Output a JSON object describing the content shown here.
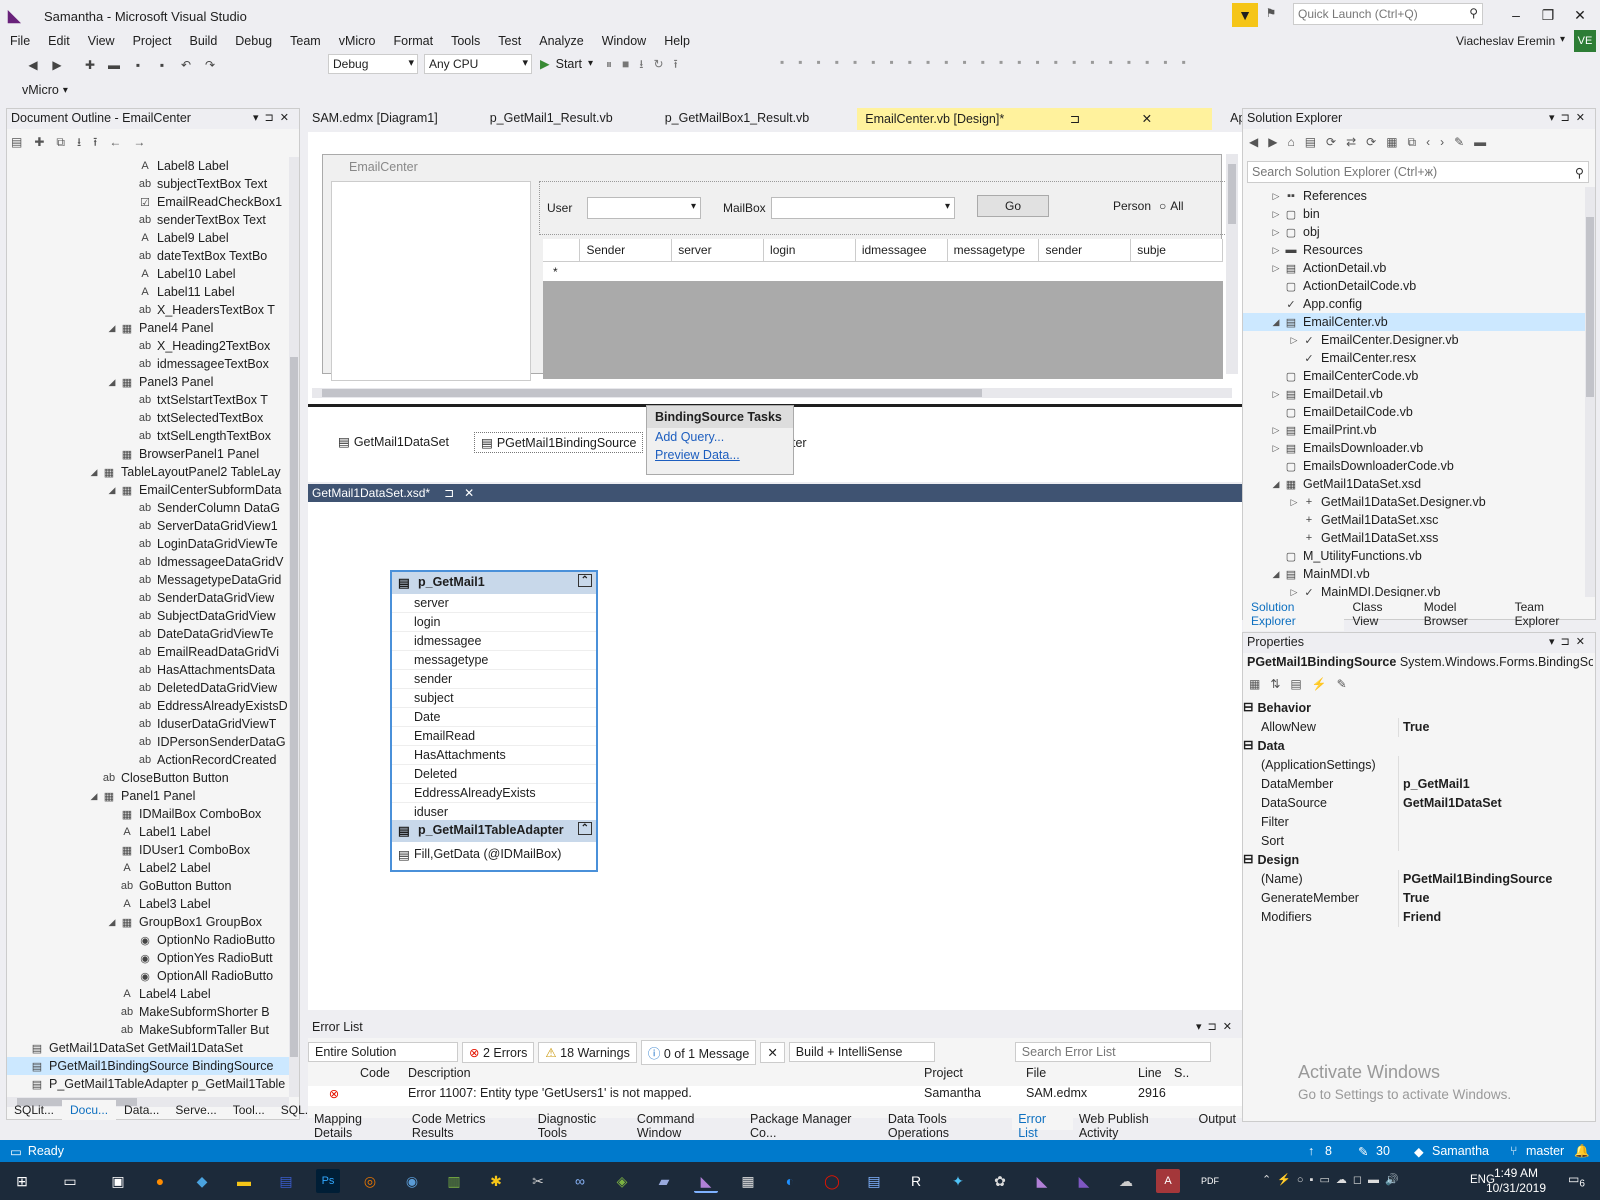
{
  "window": {
    "title": "Samantha - Microsoft Visual Studio",
    "quick_launch": "Quick Launch (Ctrl+Q)",
    "user": "Viacheslav Eremin",
    "user_initials": "VE"
  },
  "menu": [
    "File",
    "Edit",
    "View",
    "Project",
    "Build",
    "Debug",
    "Team",
    "vMicro",
    "Format",
    "Tools",
    "Test",
    "Analyze",
    "Window",
    "Help"
  ],
  "toolbar": {
    "config": "Debug",
    "platform": "Any CPU",
    "start": "Start",
    "vmicro": "vMicro"
  },
  "doc_outline": {
    "title": "Document Outline - EmailCenter",
    "items": [
      {
        "indent": 7,
        "exp": "",
        "icon": "A",
        "text": "Label8  Label"
      },
      {
        "indent": 7,
        "exp": "",
        "icon": "ab",
        "text": "subjectTextBox  Text"
      },
      {
        "indent": 7,
        "exp": "",
        "icon": "☑",
        "text": "EmailReadCheckBox1"
      },
      {
        "indent": 7,
        "exp": "",
        "icon": "ab",
        "text": "senderTextBox  Text"
      },
      {
        "indent": 7,
        "exp": "",
        "icon": "A",
        "text": "Label9  Label"
      },
      {
        "indent": 7,
        "exp": "",
        "icon": "ab",
        "text": "dateTextBox  TextBo"
      },
      {
        "indent": 7,
        "exp": "",
        "icon": "A",
        "text": "Label10  Label"
      },
      {
        "indent": 7,
        "exp": "",
        "icon": "A",
        "text": "Label11  Label"
      },
      {
        "indent": 7,
        "exp": "",
        "icon": "ab",
        "text": "X_HeadersTextBox  T"
      },
      {
        "indent": 6,
        "exp": "◢",
        "icon": "▦",
        "text": "Panel4  Panel"
      },
      {
        "indent": 7,
        "exp": "",
        "icon": "ab",
        "text": "X_Heading2TextBox"
      },
      {
        "indent": 7,
        "exp": "",
        "icon": "ab",
        "text": "idmessageeTextBox"
      },
      {
        "indent": 6,
        "exp": "◢",
        "icon": "▦",
        "text": "Panel3  Panel"
      },
      {
        "indent": 7,
        "exp": "",
        "icon": "ab",
        "text": "txtSelstartTextBox  T"
      },
      {
        "indent": 7,
        "exp": "",
        "icon": "ab",
        "text": "txtSelectedTextBox"
      },
      {
        "indent": 7,
        "exp": "",
        "icon": "ab",
        "text": "txtSelLengthTextBox"
      },
      {
        "indent": 6,
        "exp": "",
        "icon": "▦",
        "text": "BrowserPanel1  Panel"
      },
      {
        "indent": 5,
        "exp": "◢",
        "icon": "▦",
        "text": "TableLayoutPanel2  TableLay"
      },
      {
        "indent": 6,
        "exp": "◢",
        "icon": "▦",
        "text": "EmailCenterSubformData"
      },
      {
        "indent": 7,
        "exp": "",
        "icon": "ab",
        "text": "SenderColumn  DataG"
      },
      {
        "indent": 7,
        "exp": "",
        "icon": "ab",
        "text": "ServerDataGridView1"
      },
      {
        "indent": 7,
        "exp": "",
        "icon": "ab",
        "text": "LoginDataGridViewTe"
      },
      {
        "indent": 7,
        "exp": "",
        "icon": "ab",
        "text": "IdmessageeDataGridV"
      },
      {
        "indent": 7,
        "exp": "",
        "icon": "ab",
        "text": "MessagetypeDataGrid"
      },
      {
        "indent": 7,
        "exp": "",
        "icon": "ab",
        "text": "SenderDataGridView"
      },
      {
        "indent": 7,
        "exp": "",
        "icon": "ab",
        "text": "SubjectDataGridView"
      },
      {
        "indent": 7,
        "exp": "",
        "icon": "ab",
        "text": "DateDataGridViewTe"
      },
      {
        "indent": 7,
        "exp": "",
        "icon": "ab",
        "text": "EmailReadDataGridVi"
      },
      {
        "indent": 7,
        "exp": "",
        "icon": "ab",
        "text": "HasAttachmentsData"
      },
      {
        "indent": 7,
        "exp": "",
        "icon": "ab",
        "text": "DeletedDataGridView"
      },
      {
        "indent": 7,
        "exp": "",
        "icon": "ab",
        "text": "EddressAlreadyExistsD"
      },
      {
        "indent": 7,
        "exp": "",
        "icon": "ab",
        "text": "IduserDataGridViewT"
      },
      {
        "indent": 7,
        "exp": "",
        "icon": "ab",
        "text": "IDPersonSenderDataG"
      },
      {
        "indent": 7,
        "exp": "",
        "icon": "ab",
        "text": "ActionRecordCreated"
      },
      {
        "indent": 5,
        "exp": "",
        "icon": "ab",
        "text": "CloseButton  Button"
      },
      {
        "indent": 5,
        "exp": "◢",
        "icon": "▦",
        "text": "Panel1  Panel"
      },
      {
        "indent": 6,
        "exp": "",
        "icon": "▦",
        "text": "IDMailBox  ComboBox"
      },
      {
        "indent": 6,
        "exp": "",
        "icon": "A",
        "text": "Label1  Label"
      },
      {
        "indent": 6,
        "exp": "",
        "icon": "▦",
        "text": "IDUser1  ComboBox"
      },
      {
        "indent": 6,
        "exp": "",
        "icon": "A",
        "text": "Label2  Label"
      },
      {
        "indent": 6,
        "exp": "",
        "icon": "ab",
        "text": "GoButton  Button"
      },
      {
        "indent": 6,
        "exp": "",
        "icon": "A",
        "text": "Label3  Label"
      },
      {
        "indent": 6,
        "exp": "◢",
        "icon": "▦",
        "text": "GroupBox1  GroupBox"
      },
      {
        "indent": 7,
        "exp": "",
        "icon": "◉",
        "text": "OptionNo  RadioButto"
      },
      {
        "indent": 7,
        "exp": "",
        "icon": "◉",
        "text": "OptionYes  RadioButt"
      },
      {
        "indent": 7,
        "exp": "",
        "icon": "◉",
        "text": "OptionAll  RadioButto"
      },
      {
        "indent": 6,
        "exp": "",
        "icon": "A",
        "text": "Label4  Label"
      },
      {
        "indent": 6,
        "exp": "",
        "icon": "ab",
        "text": "MakeSubformShorter  B"
      },
      {
        "indent": 6,
        "exp": "",
        "icon": "ab",
        "text": "MakeSubformTaller  But"
      },
      {
        "indent": 1,
        "exp": "",
        "icon": "▤",
        "text": "GetMail1DataSet  GetMail1DataSet"
      },
      {
        "indent": 1,
        "exp": "",
        "icon": "▤",
        "text": "PGetMail1BindingSource  BindingSource",
        "selected": true
      },
      {
        "indent": 1,
        "exp": "",
        "icon": "▤",
        "text": "P_GetMail1TableAdapter  p_GetMail1Table"
      }
    ],
    "tabs": [
      "SQLit...",
      "Docu...",
      "Data...",
      "Serve...",
      "Tool...",
      "SQL..."
    ]
  },
  "doc_tabs": [
    "SAM.edmx [Diagram1]",
    "p_GetMail1_Result.vb",
    "p_GetMailBox1_Result.vb",
    "EmailCenter.vb [Design]*",
    "App.config"
  ],
  "designer": {
    "form_title": "EmailCenter",
    "user_label": "User",
    "mailbox_label": "MailBox",
    "go": "Go",
    "person_label": "Person",
    "all_label": "All",
    "grid_cols": [
      "Sender",
      "server",
      "login",
      "idmessagee",
      "messagetype",
      "sender",
      "subje"
    ],
    "new_row": "*",
    "components": [
      "GetMail1DataSet",
      "PGetMail1BindingSource",
      "ter"
    ],
    "tasks": {
      "title": "BindingSource Tasks",
      "items": [
        "Add Query...",
        "Preview Data..."
      ]
    }
  },
  "xsd": {
    "tab": "GetMail1DataSet.xsd*",
    "table": "p_GetMail1",
    "columns": [
      "server",
      "login",
      "idmessagee",
      "messagetype",
      "sender",
      "subject",
      "Date",
      "EmailRead",
      "HasAttachments",
      "Deleted",
      "EddressAlreadyExists",
      "iduser"
    ],
    "adapter": "p_GetMail1TableAdapter",
    "fill": "Fill,GetData (@IDMailBox)"
  },
  "errors": {
    "title": "Error List",
    "scope": "Entire Solution",
    "errors": "2 Errors",
    "warnings": "18 Warnings",
    "messages": "0 of 1 Message",
    "build": "Build + IntelliSense",
    "search": "Search Error List",
    "headers": [
      "",
      "Code",
      "Description",
      "Project",
      "File",
      "Line",
      "S.."
    ],
    "row": {
      "code": "",
      "desc": "Error 11007: Entity type 'GetUsers1' is not mapped.",
      "project": "Samantha",
      "file": "SAM.edmx",
      "line": "2916"
    }
  },
  "bottom_tabs": [
    "Mapping Details",
    "Code Metrics Results",
    "Diagnostic Tools",
    "Command Window",
    "Package Manager Co...",
    "Data Tools Operations",
    "Error List",
    "Web Publish Activity",
    "Output"
  ],
  "solution": {
    "title": "Solution Explorer",
    "search": "Search Solution Explorer (Ctrl+ж)",
    "items": [
      {
        "indent": 2,
        "exp": "▷",
        "icon": "▪▪",
        "text": "References"
      },
      {
        "indent": 2,
        "exp": "▷",
        "icon": "▢",
        "text": "bin"
      },
      {
        "indent": 2,
        "exp": "▷",
        "icon": "▢",
        "text": "obj"
      },
      {
        "indent": 2,
        "exp": "▷",
        "icon": "▬",
        "text": "Resources"
      },
      {
        "indent": 2,
        "exp": "▷",
        "icon": "▤",
        "text": "ActionDetail.vb"
      },
      {
        "indent": 2,
        "exp": "",
        "icon": "▢",
        "text": "ActionDetailCode.vb"
      },
      {
        "indent": 2,
        "exp": "",
        "icon": "✓",
        "text": "App.config"
      },
      {
        "indent": 2,
        "exp": "◢",
        "icon": "▤",
        "text": "EmailCenter.vb",
        "selected": true
      },
      {
        "indent": 3,
        "exp": "▷",
        "icon": "✓",
        "text": "EmailCenter.Designer.vb"
      },
      {
        "indent": 3,
        "exp": "",
        "icon": "✓",
        "text": "EmailCenter.resx"
      },
      {
        "indent": 2,
        "exp": "",
        "icon": "▢",
        "text": "EmailCenterCode.vb"
      },
      {
        "indent": 2,
        "exp": "▷",
        "icon": "▤",
        "text": "EmailDetail.vb"
      },
      {
        "indent": 2,
        "exp": "",
        "icon": "▢",
        "text": "EmailDetailCode.vb"
      },
      {
        "indent": 2,
        "exp": "▷",
        "icon": "▤",
        "text": "EmailPrint.vb"
      },
      {
        "indent": 2,
        "exp": "▷",
        "icon": "▤",
        "text": "EmailsDownloader.vb"
      },
      {
        "indent": 2,
        "exp": "",
        "icon": "▢",
        "text": "EmailsDownloaderCode.vb"
      },
      {
        "indent": 2,
        "exp": "◢",
        "icon": "▦",
        "text": "GetMail1DataSet.xsd"
      },
      {
        "indent": 3,
        "exp": "▷",
        "icon": "+",
        "text": "GetMail1DataSet.Designer.vb"
      },
      {
        "indent": 3,
        "exp": "",
        "icon": "+",
        "text": "GetMail1DataSet.xsc"
      },
      {
        "indent": 3,
        "exp": "",
        "icon": "+",
        "text": "GetMail1DataSet.xss"
      },
      {
        "indent": 2,
        "exp": "",
        "icon": "▢",
        "text": "M_UtilityFunctions.vb"
      },
      {
        "indent": 2,
        "exp": "◢",
        "icon": "▤",
        "text": "MainMDI.vb"
      },
      {
        "indent": 3,
        "exp": "▷",
        "icon": "✓",
        "text": "MainMDI.Designer.vb"
      }
    ],
    "tabs": [
      "Solution Explorer",
      "Class View",
      "Model Browser",
      "Team Explorer"
    ]
  },
  "properties": {
    "title": "Properties",
    "object": "PGetMail1BindingSource",
    "type": "System.Windows.Forms.BindingSou",
    "rows": [
      {
        "cat": true,
        "k": "Behavior",
        "v": ""
      },
      {
        "k": "AllowNew",
        "v": "True"
      },
      {
        "cat": true,
        "k": "Data",
        "v": ""
      },
      {
        "k": "(ApplicationSettings)",
        "v": ""
      },
      {
        "k": "DataMember",
        "v": "p_GetMail1"
      },
      {
        "k": "DataSource",
        "v": "GetMail1DataSet"
      },
      {
        "k": "Filter",
        "v": ""
      },
      {
        "k": "Sort",
        "v": ""
      },
      {
        "cat": true,
        "k": "Design",
        "v": ""
      },
      {
        "k": "(Name)",
        "v": "PGetMail1BindingSource"
      },
      {
        "k": "GenerateMember",
        "v": "True"
      },
      {
        "k": "Modifiers",
        "v": "Friend"
      }
    ]
  },
  "watermark": {
    "line1": "Activate Windows",
    "line2": "Go to Settings to activate Windows."
  },
  "status": {
    "ready": "Ready",
    "up": "8",
    "edits": "30",
    "repo": "Samantha",
    "branch": "master"
  },
  "taskbar": {
    "time": "1:49 AM",
    "date": "10/31/2019",
    "lang": "ENG",
    "notif": "6"
  },
  "colors": {
    "accent": "#007acc",
    "selected": "#cce8ff",
    "active_tab": "#fff29d"
  }
}
